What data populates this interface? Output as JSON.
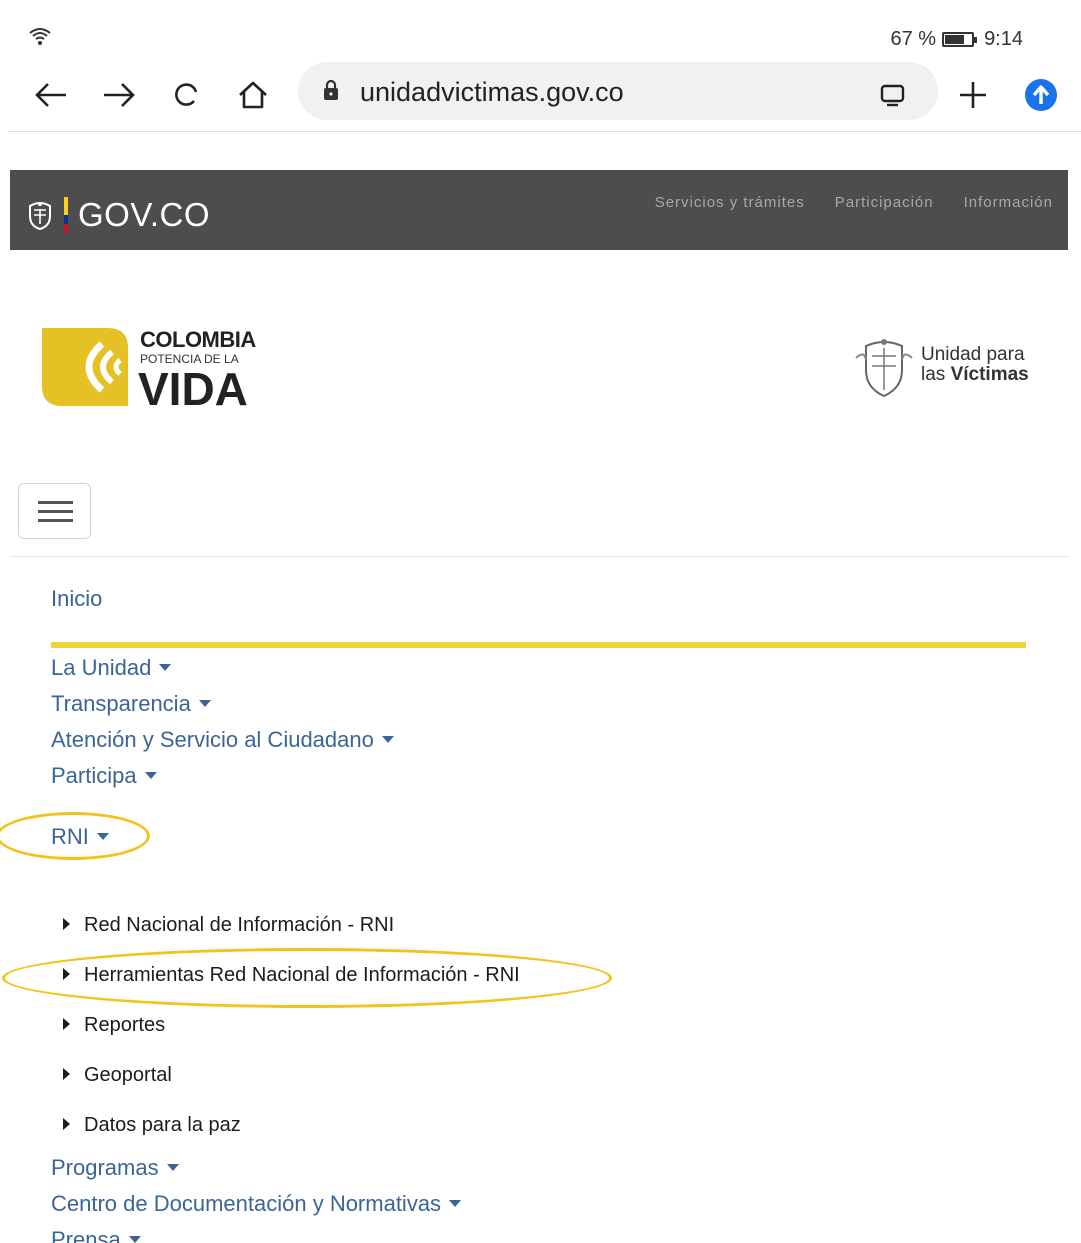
{
  "status_bar": {
    "battery_percent": "67 %",
    "time": "9:14"
  },
  "browser": {
    "url": "unidadvictimas.gov.co"
  },
  "gov_header": {
    "logo_text": "GOV.CO",
    "links": [
      "Servicios y trámites",
      "Participación",
      "Información"
    ]
  },
  "brand": {
    "line1": "COLOMBIA",
    "line2": "POTENCIA DE LA",
    "line3": "VIDA",
    "uv_line1": "Unidad para",
    "uv_line2_a": "las ",
    "uv_line2_b": "Víctimas"
  },
  "nav": {
    "home": "Inicio",
    "items": [
      "La Unidad",
      "Transparencia",
      "Atención y Servicio al Ciudadano",
      "Participa",
      "RNI"
    ],
    "rni_sub": [
      "Red Nacional de Información - RNI",
      "Herramientas Red Nacional de Información - RNI",
      "Reportes",
      "Geoportal",
      "Datos para la paz"
    ],
    "items_after": [
      "Programas",
      "Centro de Documentación y Normativas",
      "Prensa"
    ]
  },
  "colors": {
    "gov_bar": "#4d4d4d",
    "accent_yellow": "#f3d33b",
    "link_blue": "#3a6596",
    "brand_yellow": "#e6c125"
  }
}
